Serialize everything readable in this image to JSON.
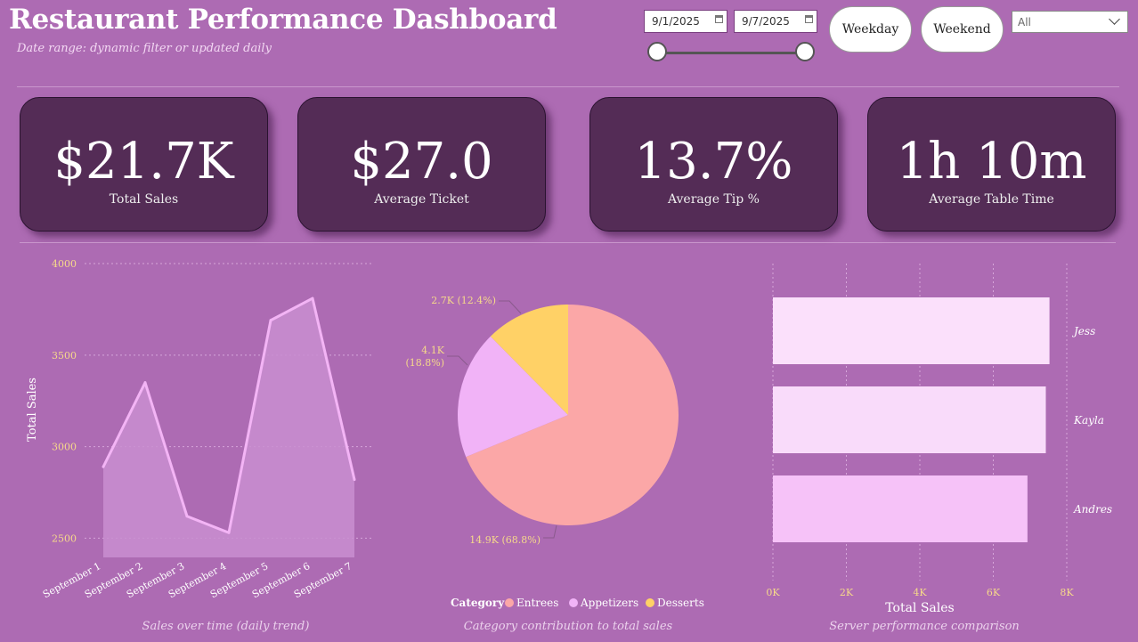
{
  "header": {
    "title": "Restaurant Performance Dashboard",
    "subtitle": "Date range: dynamic filter or updated daily"
  },
  "filters": {
    "start_date": "9/1/2025",
    "end_date": "9/7/2025",
    "weekday_label": "Weekday",
    "weekend_label": "Weekend",
    "dropdown_value": "All"
  },
  "kpis": [
    {
      "value": "$21.7K",
      "label": "Total Sales"
    },
    {
      "value": "$27.0",
      "label": "Average Ticket"
    },
    {
      "value": "13.7%",
      "label": "Average Tip %"
    },
    {
      "value": "1h 10m",
      "label": "Average Table Time"
    }
  ],
  "colors": {
    "background": "#ad6bb3",
    "card": "#542c56",
    "line": "#f3b4f5",
    "area": "#c98ed0",
    "tick": "#f6d98a",
    "entrees": "#fba7a7",
    "appetizers": "#f1b3f7",
    "desserts": "#ffd166",
    "bar1": "#fbe0fb",
    "bar2": "#f9dbfa",
    "bar3": "#f6c2f8"
  },
  "chart_data": [
    {
      "type": "area",
      "caption": "Sales over time (daily trend)",
      "ylabel": "Total Sales",
      "categories": [
        "September 1",
        "September 2",
        "September 3",
        "September 4",
        "September 5",
        "September 6",
        "September 7"
      ],
      "values": [
        2890,
        3350,
        2620,
        2530,
        3690,
        3810,
        2820
      ],
      "yticks": [
        "4000",
        "3500",
        "3000",
        "2500"
      ],
      "ytick_values": [
        4000,
        3500,
        3000,
        2500
      ],
      "ylim": [
        2395,
        4005
      ],
      "grid": true
    },
    {
      "type": "pie",
      "caption": "Category contribution to total sales",
      "legend_title": "Category",
      "slices": [
        {
          "name": "Entrees",
          "value": 14.9,
          "percent": 68.8,
          "label": "14.9K (68.8%)"
        },
        {
          "name": "Appetizers",
          "value": 4.1,
          "percent": 18.8,
          "label_line1": "4.1K",
          "label_line2": "(18.8%)"
        },
        {
          "name": "Desserts",
          "value": 2.7,
          "percent": 12.4,
          "label": "2.7K (12.4%)"
        }
      ]
    },
    {
      "type": "bar",
      "orientation": "horizontal",
      "caption": "Server performance comparison",
      "xlabel": "Total Sales",
      "categories": [
        "Jess",
        "Kayla",
        "Andres"
      ],
      "values": [
        7530,
        7430,
        6930
      ],
      "xticks": [
        "0K",
        "2K",
        "4K",
        "6K",
        "8K"
      ],
      "xtick_values": [
        0,
        2000,
        4000,
        6000,
        8000
      ],
      "xlim": [
        0,
        8000
      ],
      "grid": true
    }
  ]
}
